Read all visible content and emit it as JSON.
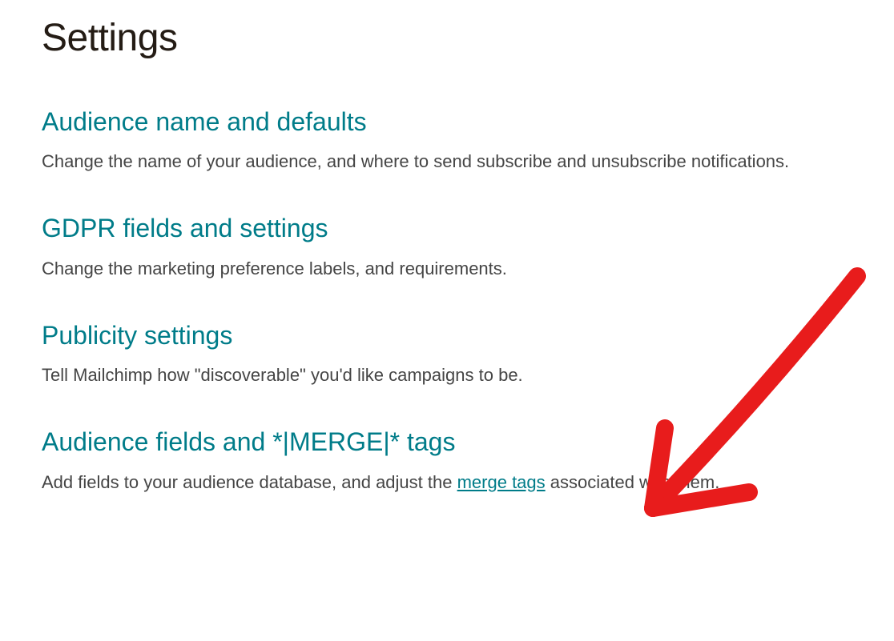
{
  "page": {
    "title": "Settings"
  },
  "sections": [
    {
      "heading": "Audience name and defaults",
      "description": "Change the name of your audience, and where to send subscribe and unsubscribe notifications."
    },
    {
      "heading": "GDPR fields and settings",
      "description": "Change the marketing preference labels, and requirements."
    },
    {
      "heading": "Publicity settings",
      "description": "Tell Mailchimp how \"discoverable\" you'd like campaigns to be."
    },
    {
      "heading": "Audience fields and *|MERGE|* tags",
      "description_before": "Add fields to your audience database, and adjust the ",
      "description_link": "merge tags",
      "description_after": " associated with them."
    }
  ],
  "annotation": {
    "type": "hand-drawn-arrow",
    "color": "#e81c1c",
    "points_to": "Audience fields and *|MERGE|* tags"
  }
}
